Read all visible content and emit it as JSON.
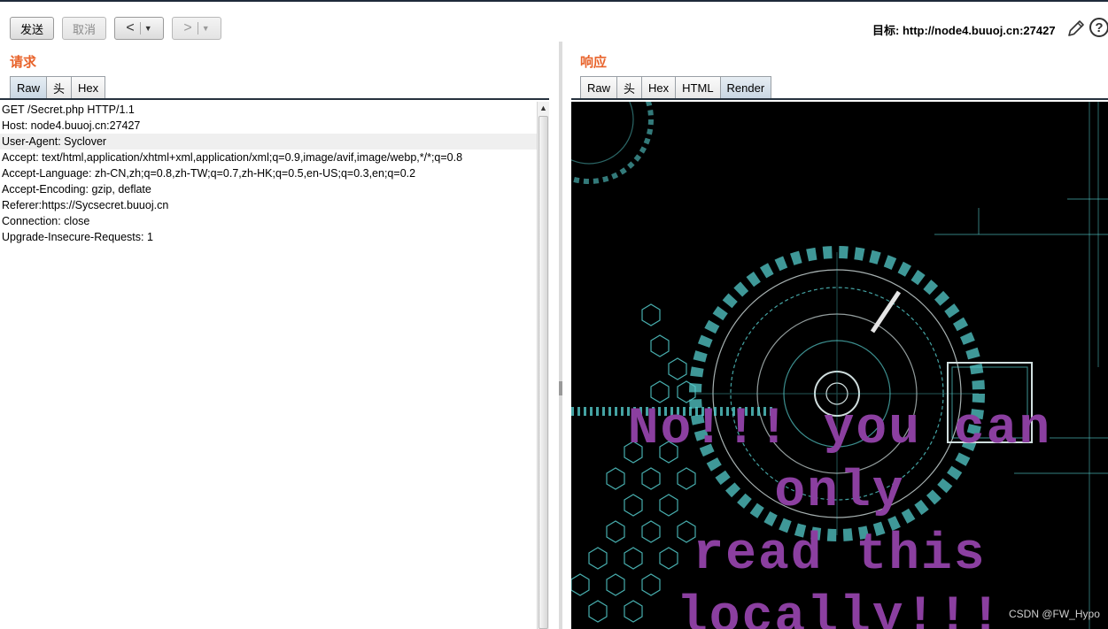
{
  "toolbar": {
    "send_label": "发送",
    "cancel_label": "取消",
    "back_label": "<",
    "forward_label": ">",
    "dropdown_glyph": "▼",
    "target_text": "目标: http://node4.buuoj.cn:27427",
    "help_label": "?"
  },
  "request": {
    "title": "请求",
    "tabs": [
      "Raw",
      "头",
      "Hex"
    ],
    "active_tab": "Raw",
    "lines": [
      "GET /Secret.php HTTP/1.1",
      "Host: node4.buuoj.cn:27427",
      "User-Agent: Syclover",
      "Accept: text/html,application/xhtml+xml,application/xml;q=0.9,image/avif,image/webp,*/*;q=0.8",
      "Accept-Language: zh-CN,zh;q=0.8,zh-TW;q=0.7,zh-HK;q=0.5,en-US;q=0.3,en;q=0.2",
      "Accept-Encoding: gzip, deflate",
      "Referer:https://Sycsecret.buuoj.cn",
      "Connection: close",
      "Upgrade-Insecure-Requests: 1"
    ],
    "highlighted_line": 2
  },
  "response": {
    "title": "响应",
    "tabs": [
      "Raw",
      "头",
      "Hex",
      "HTML",
      "Render"
    ],
    "active_tab": "Render",
    "render_text_lines": [
      "No!!! you can only",
      "read this",
      "locally!!!"
    ],
    "render_text_color": "#8b3fa0",
    "background_color": "#000000",
    "graphic_accent": "#5fe3e3"
  },
  "watermark": "CSDN @FW_Hypo",
  "icons": {
    "edit": "pencil-icon",
    "help": "help-icon"
  },
  "colors": {
    "pane_title": "#e8632b",
    "active_tab": "#c8d6e3"
  }
}
